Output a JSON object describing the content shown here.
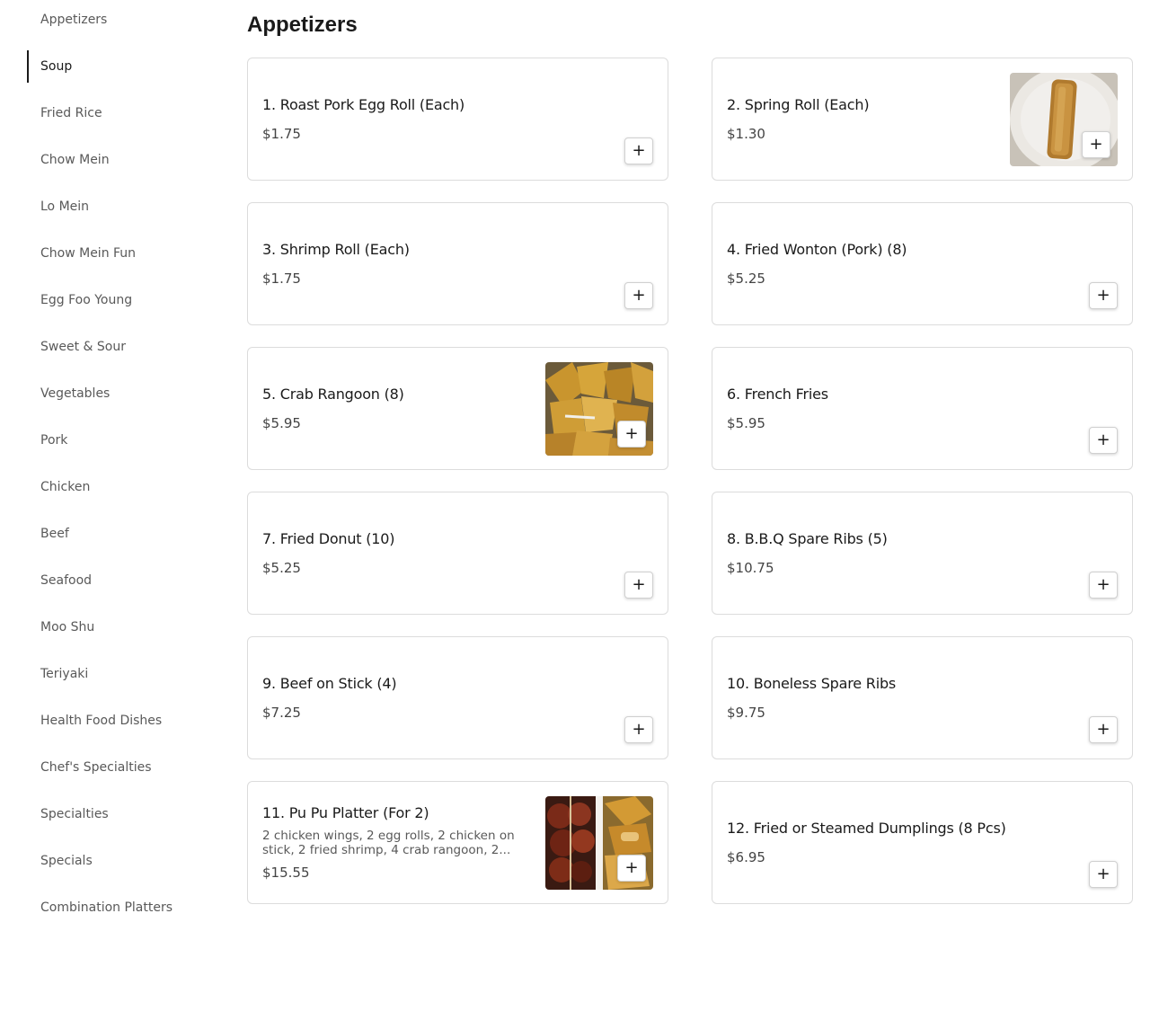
{
  "sidebar": {
    "items": [
      {
        "label": "Appetizers"
      },
      {
        "label": "Soup"
      },
      {
        "label": "Fried Rice"
      },
      {
        "label": "Chow Mein"
      },
      {
        "label": "Lo Mein"
      },
      {
        "label": "Chow Mein Fun"
      },
      {
        "label": "Egg Foo Young"
      },
      {
        "label": "Sweet & Sour"
      },
      {
        "label": "Vegetables"
      },
      {
        "label": "Pork"
      },
      {
        "label": "Chicken"
      },
      {
        "label": "Beef"
      },
      {
        "label": "Seafood"
      },
      {
        "label": "Moo Shu"
      },
      {
        "label": "Teriyaki"
      },
      {
        "label": "Health Food Dishes"
      },
      {
        "label": "Chef's Specialties"
      },
      {
        "label": "Specialties"
      },
      {
        "label": "Specials"
      },
      {
        "label": "Combination Platters"
      }
    ],
    "active": "Soup"
  },
  "section": {
    "title": "Appetizers",
    "add_symbol": "+",
    "items": [
      {
        "name": "1. Roast Pork Egg Roll (Each)",
        "price": "$1.75"
      },
      {
        "name": "2. Spring Roll (Each)",
        "price": "$1.30",
        "image": "spring-roll-photo"
      },
      {
        "name": "3. Shrimp Roll (Each)",
        "price": "$1.75"
      },
      {
        "name": "4. Fried Wonton (Pork) (8)",
        "price": "$5.25"
      },
      {
        "name": "5. Crab Rangoon (8)",
        "price": "$5.95",
        "image": "crab-rangoon-photo"
      },
      {
        "name": "6. French Fries",
        "price": "$5.95"
      },
      {
        "name": "7. Fried Donut (10)",
        "price": "$5.25"
      },
      {
        "name": "8. B.B.Q Spare Ribs (5)",
        "price": "$10.75"
      },
      {
        "name": "9. Beef on Stick (4)",
        "price": "$7.25"
      },
      {
        "name": "10. Boneless Spare Ribs",
        "price": "$9.75"
      },
      {
        "name": "11. Pu Pu Platter (For 2)",
        "description": "2 chicken wings, 2 egg rolls, 2 chicken on stick, 2 fried shrimp, 4 crab rangoon, 2...",
        "price": "$15.55",
        "image": "pu-pu-platter-photo"
      },
      {
        "name": "12. Fried or Steamed Dumplings (8 Pcs)",
        "price": "$6.95"
      }
    ]
  }
}
